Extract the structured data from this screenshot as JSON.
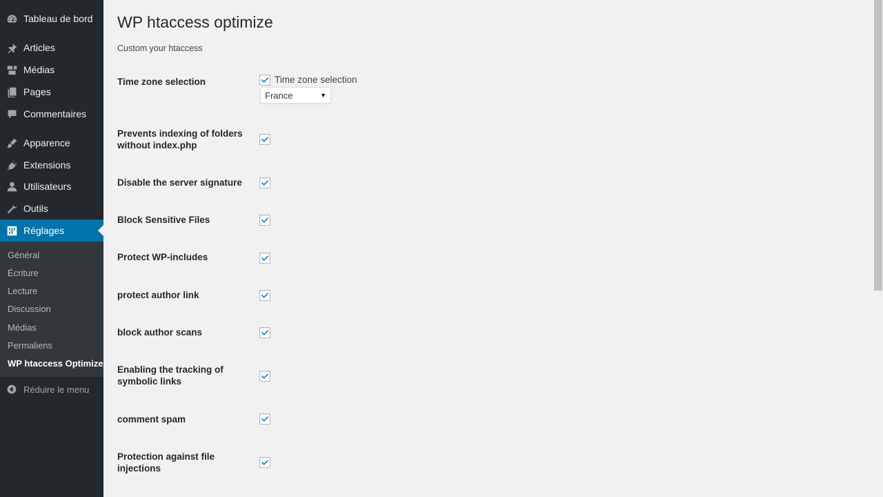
{
  "sidebar": {
    "items": [
      {
        "label": "Tableau de bord",
        "icon": "dashboard-icon"
      },
      {
        "label": "Articles",
        "icon": "pin-icon"
      },
      {
        "label": "Médias",
        "icon": "media-icon"
      },
      {
        "label": "Pages",
        "icon": "pages-icon"
      },
      {
        "label": "Commentaires",
        "icon": "comments-icon"
      },
      {
        "label": "Apparence",
        "icon": "brush-icon"
      },
      {
        "label": "Extensions",
        "icon": "plugin-icon"
      },
      {
        "label": "Utilisateurs",
        "icon": "user-icon"
      },
      {
        "label": "Outils",
        "icon": "wrench-icon"
      },
      {
        "label": "Réglages",
        "icon": "settings-icon"
      }
    ],
    "submenu": [
      "Général",
      "Écriture",
      "Lecture",
      "Discussion",
      "Médias",
      "Permaliens",
      "WP htaccess Optimize"
    ],
    "collapse_label": "Réduire le menu"
  },
  "page": {
    "title": "WP htaccess optimize",
    "subtitle": "Custom your htaccess"
  },
  "settings": {
    "timezone": {
      "label": "Time zone selection",
      "checkbox_label": "Time zone selection",
      "checked": true,
      "selected": "France"
    },
    "rows": [
      {
        "label": "Prevents indexing of folders without index.php",
        "checked": true
      },
      {
        "label": "Disable the server signature",
        "checked": true
      },
      {
        "label": "Block Sensitive Files",
        "checked": true
      },
      {
        "label": "Protect WP-includes",
        "checked": true
      },
      {
        "label": "protect author link",
        "checked": true
      },
      {
        "label": "block author scans",
        "checked": true
      },
      {
        "label": "Enabling the tracking of symbolic links",
        "checked": true
      },
      {
        "label": "comment spam",
        "checked": true
      },
      {
        "label": "Protection against file injections",
        "checked": true
      }
    ]
  },
  "colors": {
    "sidebar_bg": "#23282d",
    "submenu_bg": "#32373c",
    "accent": "#0073aa",
    "checkmark": "#1e8cbe",
    "page_bg": "#f1f1f1"
  }
}
